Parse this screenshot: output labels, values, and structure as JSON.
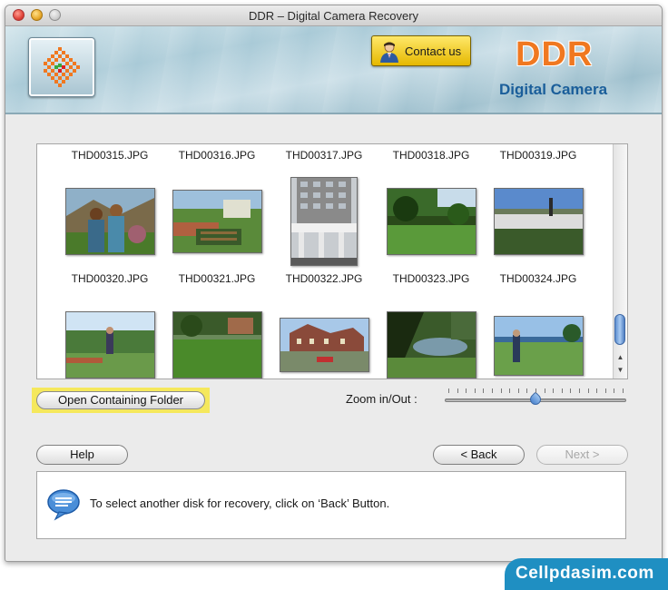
{
  "window": {
    "title": "DDR – Digital Camera Recovery"
  },
  "header": {
    "contact_label": "Contact us",
    "brand": "DDR",
    "subtitle": "Digital Camera"
  },
  "gallery": {
    "row1_names": [
      "THD00315.JPG",
      "THD00316.JPG",
      "THD00317.JPG",
      "THD00318.JPG",
      "THD00319.JPG"
    ],
    "row2_names": [
      "THD00320.JPG",
      "THD00321.JPG",
      "THD00322.JPG",
      "THD00323.JPG",
      "THD00324.JPG"
    ]
  },
  "open_folder_label": "Open Containing Folder",
  "zoom": {
    "label": "Zoom in/Out :",
    "level": 0.5
  },
  "buttons": {
    "help": "Help",
    "back": "< Back",
    "next": "Next >"
  },
  "info": {
    "message": "To select another disk for recovery, click on ‘Back’ Button."
  },
  "watermark": "Cellpdasim.com",
  "colors": {
    "brand_orange": "#f07820",
    "brand_blue": "#1a5e9a",
    "highlight": "#f5e85c"
  }
}
